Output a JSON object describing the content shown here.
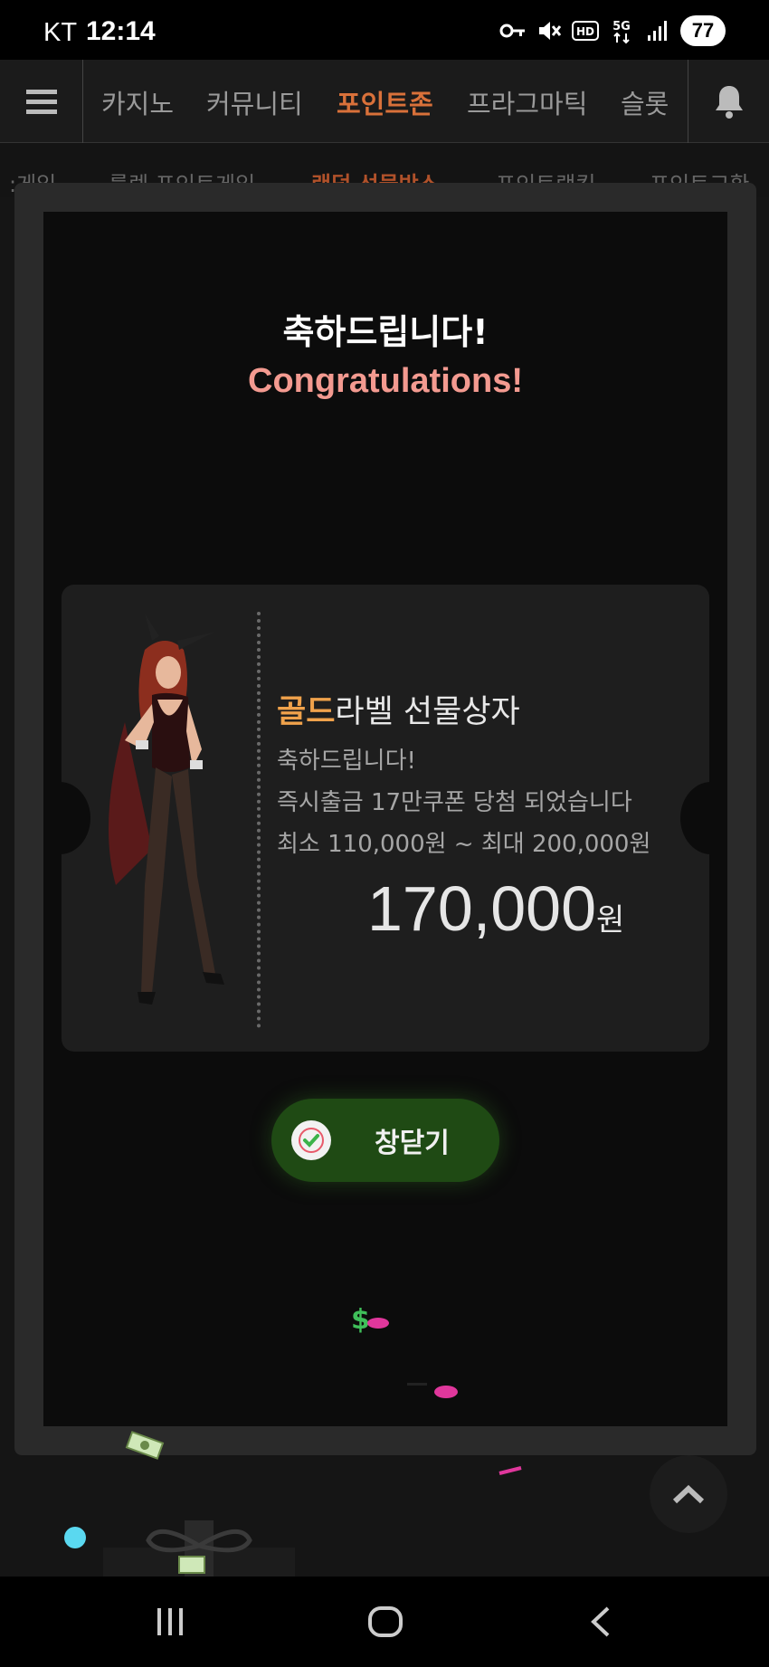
{
  "status_bar": {
    "carrier": "KT",
    "time": "12:14",
    "battery": "77",
    "icons": [
      "key-icon",
      "mute-icon",
      "hd-icon",
      "5g-icon",
      "signal-icon"
    ]
  },
  "top_nav": {
    "items": [
      {
        "label": "카지노"
      },
      {
        "label": "커뮤니티"
      },
      {
        "label": "포인트존",
        "active": true
      },
      {
        "label": "프라그마틱"
      },
      {
        "label": "슬롯"
      }
    ]
  },
  "sub_nav": {
    "items": [
      {
        "label": ":게임"
      },
      {
        "label": "룰렛 포인트게임"
      },
      {
        "label": "랜덤 선물박스",
        "active": true
      },
      {
        "label": "포인트랭킹"
      },
      {
        "label": "포인트교환"
      }
    ]
  },
  "modal": {
    "title_ko": "축하드립니다!",
    "title_en": "Congratulations!",
    "prize": {
      "title_accent": "골드",
      "title_rest": "라벨 선물상자",
      "line1": "축하드립니다!",
      "line2": "즉시출금 17만쿠폰 당첨 되었습니다",
      "line3": "최소 110,000원 ~ 최대 200,000원",
      "amount": "170,000",
      "unit": "원"
    },
    "close_button": "창닫기"
  },
  "colors": {
    "accent_orange": "#d9713a",
    "gold": "#f0a24b",
    "congrats_pink": "#f39a90",
    "close_green": "#1f4a14"
  }
}
